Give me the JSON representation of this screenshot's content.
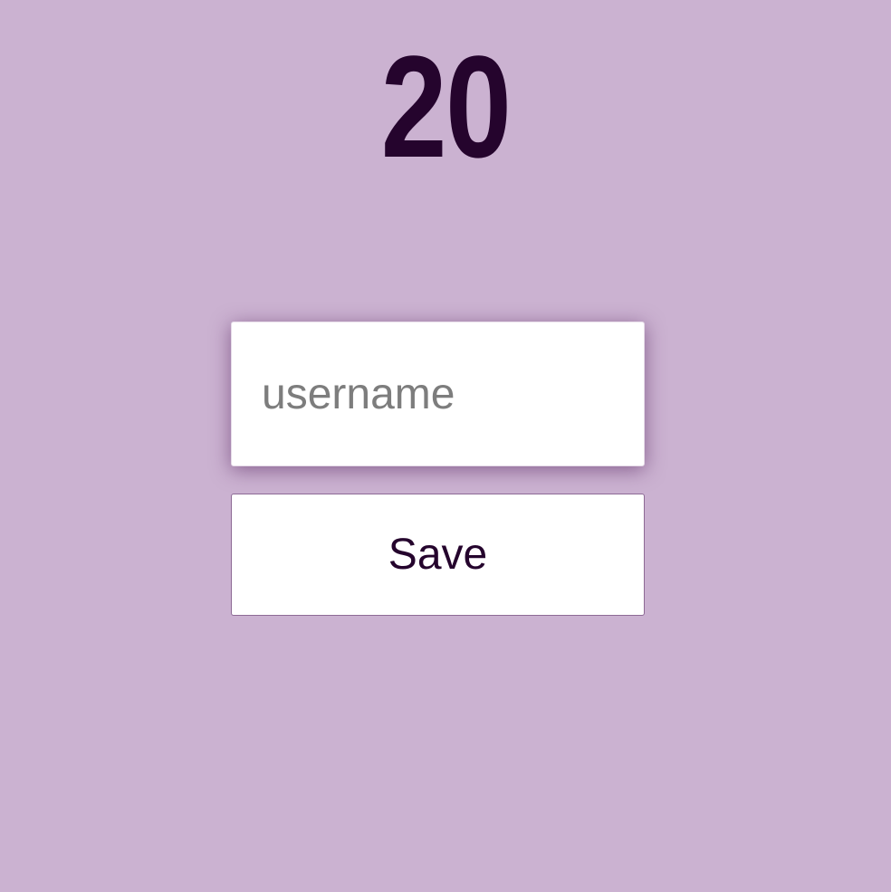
{
  "score": "20",
  "form": {
    "username_placeholder": "username",
    "username_value": "",
    "save_label": "Save"
  },
  "colors": {
    "background": "#cbb2d1",
    "text": "#25042d",
    "input_background": "#ffffff",
    "placeholder": "#7d7d7d"
  }
}
